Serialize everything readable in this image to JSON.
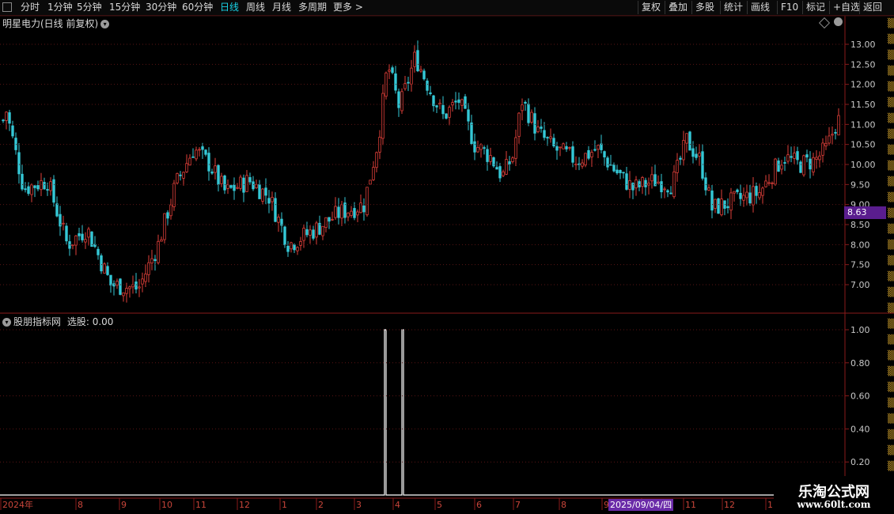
{
  "toolbar": {
    "periods": [
      "分时",
      "1分钟",
      "5分钟",
      "15分钟",
      "30分钟",
      "60分钟",
      "日线",
      "周线",
      "月线",
      "多周期",
      "更多 >"
    ],
    "active": "日线",
    "right_buttons": [
      "复权",
      "叠加",
      "多股",
      "统计",
      "画线",
      "F10",
      "标记",
      "+自选",
      "返回"
    ]
  },
  "main_chart": {
    "title": "明星电力(日线 前复权)",
    "current_price_tag": "8.63",
    "y_ticks": [
      "13.00",
      "12.50",
      "12.00",
      "11.50",
      "11.00",
      "10.50",
      "10.00",
      "9.50",
      "9.00",
      "8.50",
      "8.00",
      "7.50",
      "7.00"
    ]
  },
  "sub_chart": {
    "title": "股朋指标网",
    "value_label": "选股: 0.00",
    "y_ticks": [
      "1.00",
      "0.80",
      "0.60",
      "0.40",
      "0.20"
    ]
  },
  "x_axis": {
    "labels": [
      "2024年",
      "8",
      "9",
      "10",
      "11",
      "12",
      "1",
      "2",
      "3",
      "4",
      "5",
      "6",
      "7",
      "8",
      "9",
      "10",
      "11",
      "12",
      "1"
    ],
    "cursor_date": "2025/09/04/四"
  },
  "watermark": {
    "line1": "乐淘公式网",
    "line2": "www.60lt.com"
  },
  "colors": {
    "up": "#e0403a",
    "down": "#35c8d6",
    "accent": "#19d2e6",
    "grid": "#5a1414",
    "tag": "#5a1d8e"
  },
  "chart_data": [
    {
      "type": "candlestick",
      "title": "明星电力(日线 前复权)",
      "x": [
        "2024-07",
        "2024-08",
        "2024-09",
        "2024-10",
        "2024-11",
        "2024-12",
        "2025-01",
        "2025-02",
        "2025-03",
        "2025-04",
        "2025-05",
        "2025-06",
        "2025-07",
        "2025-08",
        "2025-09",
        "2025-10",
        "2025-11",
        "2025-12",
        "2026-01"
      ],
      "close_by_month": [
        11.3,
        7.9,
        6.8,
        8.6,
        9.8,
        9.1,
        8.0,
        8.4,
        8.8,
        11.9,
        11.4,
        10.2,
        10.6,
        10.2,
        9.9,
        9.5,
        10.3,
        9.0,
        10.1
      ],
      "last_close": 11.0,
      "ylim": [
        6.5,
        13.3
      ],
      "current_price": 8.63
    },
    {
      "type": "line",
      "title": "股朋指标网",
      "series": [
        {
          "name": "选股",
          "points": [
            [
              "2025-03-27",
              1
            ],
            [
              "2025-04-08",
              1
            ]
          ],
          "baseline": 0
        }
      ],
      "ylim": [
        0,
        1.05
      ]
    }
  ]
}
